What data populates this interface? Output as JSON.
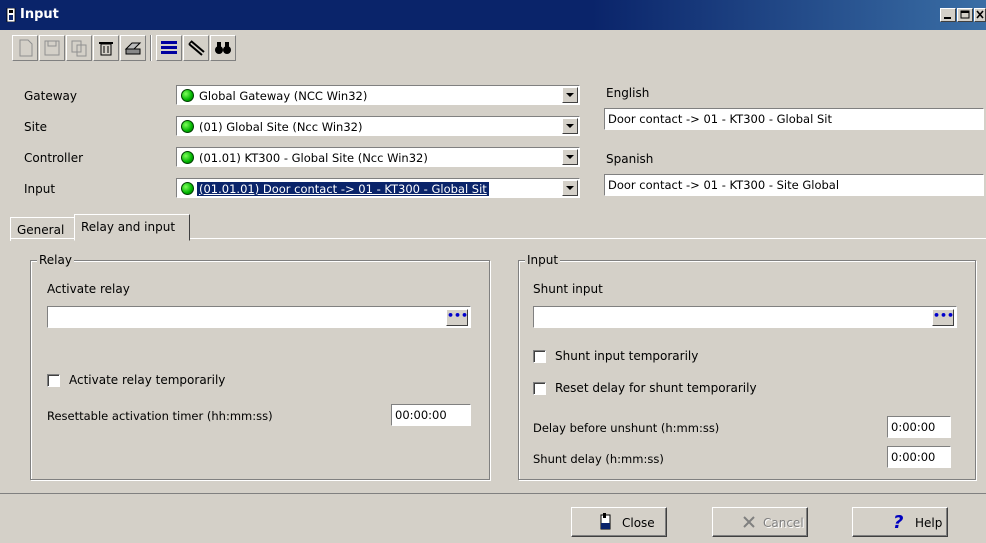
{
  "window": {
    "title": "Input"
  },
  "toolbar": {
    "buttons": [
      "new-icon",
      "save-icon",
      "copy-icon",
      "delete-icon",
      "print-icon",
      "list-icon",
      "link-icon",
      "find-icon"
    ]
  },
  "filters": {
    "gateway_label": "Gateway",
    "gateway_value": "Global Gateway (NCC Win32)",
    "site_label": "Site",
    "site_value": "(01) Global  Site (Ncc Win32)",
    "controller_label": "Controller",
    "controller_value": "(01.01) KT300 - Global  Site (Ncc Win32)",
    "input_label": "Input",
    "input_value": "(01.01.01) Door contact -> 01 - KT300 - Global  Sit"
  },
  "names": {
    "english_label": "English",
    "english_value": "Door contact -> 01 - KT300 - Global  Sit",
    "spanish_label": "Spanish",
    "spanish_value": "Door contact -> 01 - KT300 - Site Global"
  },
  "tabs": {
    "general": "General",
    "relay_input": "Relay and input"
  },
  "relay": {
    "legend": "Relay",
    "activate_label": "Activate relay",
    "activate_value": "",
    "browse": "•••",
    "temp_label": "Activate relay temporarily",
    "timer_label": "Resettable activation timer (hh:mm:ss)",
    "timer_value": "00:00:00"
  },
  "input": {
    "legend": "Input",
    "shunt_label": "Shunt input",
    "shunt_value": "",
    "browse": "•••",
    "shunt_temp_label": "Shunt input temporarily",
    "reset_delay_label": "Reset delay for shunt temporarily",
    "delay_unshunt_label": "Delay before unshunt (h:mm:ss)",
    "delay_unshunt_value": "0:00:00",
    "shunt_delay_label": "Shunt delay (h:mm:ss)",
    "shunt_delay_value": "0:00:00"
  },
  "buttons": {
    "close": "Close",
    "cancel": "Cancel",
    "help": "Help"
  }
}
